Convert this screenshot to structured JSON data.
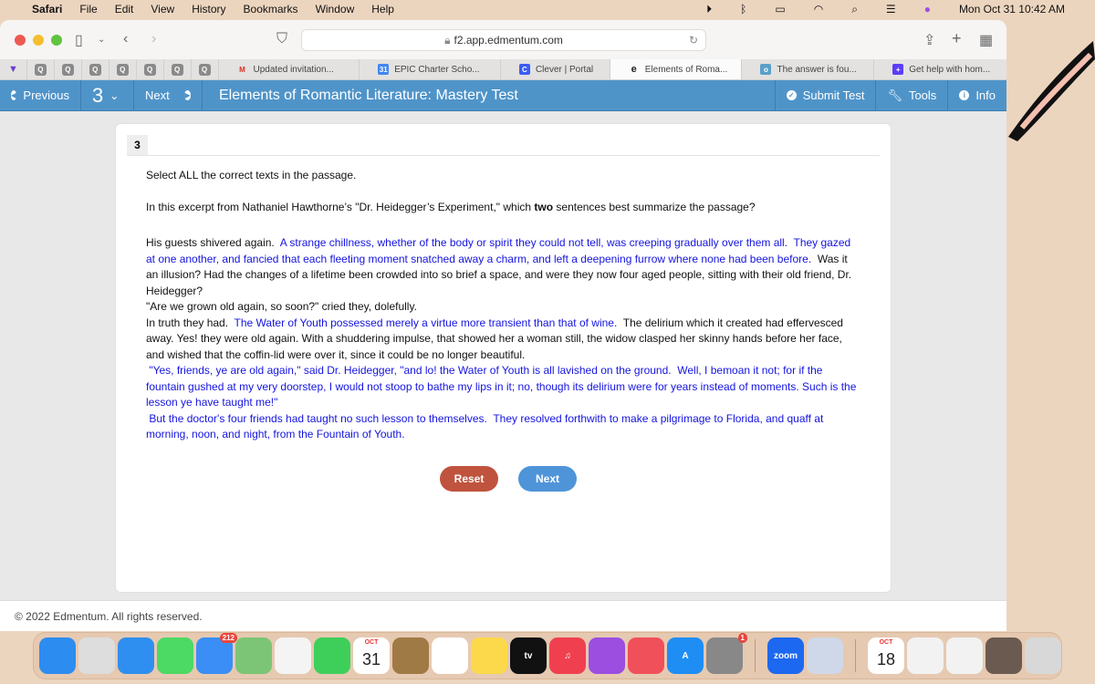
{
  "menubar": {
    "app": "Safari",
    "items": [
      "File",
      "Edit",
      "View",
      "History",
      "Bookmarks",
      "Window",
      "Help"
    ],
    "datetime": "Mon Oct 31  10:42 AM"
  },
  "browser": {
    "url": "f2.app.edmentum.com",
    "tabs": [
      {
        "label": "Updated invitation...",
        "icon": "gmail-icon",
        "color": "#d93025"
      },
      {
        "label": "EPIC Charter Scho...",
        "icon": "calendar-icon",
        "color": "#4285f4"
      },
      {
        "label": "Clever | Portal",
        "icon": "clever-icon",
        "color": "#3b5cf5"
      },
      {
        "label": "Elements of Roma...",
        "icon": "edmentum-icon",
        "color": "#222",
        "active": true
      },
      {
        "label": "The answer is fou...",
        "icon": "owl-icon",
        "color": "#5aa0c8"
      },
      {
        "label": "Get help with hom...",
        "icon": "plus-icon",
        "color": "#5b3df5"
      }
    ],
    "quick_tab_label": "Q"
  },
  "testbar": {
    "previous": "Previous",
    "question_number": "3",
    "next": "Next",
    "title": "Elements of Romantic Literature: Mastery Test",
    "submit": "Submit Test",
    "tools": "Tools",
    "info": "Info",
    "color": "#4f94c9"
  },
  "question": {
    "number": "3",
    "instruction": "Select ALL the correct texts in the passage.",
    "prompt_before": "In this excerpt from Nathaniel Hawthorne’s \"Dr. Heidegger’s Experiment,\" which ",
    "prompt_bold": "two",
    "prompt_after": " sentences best summarize the passage?",
    "selectable_color": "#1414e0",
    "paragraphs": [
      [
        {
          "text": "His guests shivered again.  ",
          "sel": false
        },
        {
          "text": "A strange chillness, whether of the body or spirit they could not tell, was creeping gradually over them all.",
          "sel": true
        },
        {
          "text": "  ",
          "sel": false
        },
        {
          "text": "They gazed at one another, and fancied that each fleeting moment snatched away a charm, and left a deepening furrow where none had been before.",
          "sel": true
        },
        {
          "text": "  Was it an illusion? Had the changes of a lifetime been crowded into so brief a space, and were they now four aged people, sitting with their old friend, Dr. Heidegger?",
          "sel": false
        }
      ],
      [
        {
          "text": "\"Are we grown old again, so soon?\" cried they, dolefully.",
          "sel": false
        }
      ],
      [
        {
          "text": "In truth they had.  ",
          "sel": false
        },
        {
          "text": "The Water of Youth possessed merely a virtue more transient than that of wine.",
          "sel": true
        },
        {
          "text": "  The delirium which it created had effervesced away. Yes! they were old again. With a shuddering impulse, that showed her a woman still, the widow clasped her skinny hands before her face, and wished that the coffin-lid were over it, since it could be no longer beautiful.",
          "sel": false
        }
      ],
      [
        {
          "text": " \"Yes, friends, ye are old again,\" said Dr. Heidegger, \"and lo! the Water of Youth is all lavished on the ground.",
          "sel": true
        },
        {
          "text": "  ",
          "sel": false
        },
        {
          "text": "Well, I bemoan it not; for if the fountain gushed at my very doorstep, I would not stoop to bathe my lips in it; no, though its delirium were for years instead of moments. Such is the lesson ye have taught me!\"",
          "sel": true
        }
      ],
      [
        {
          "text": " But the doctor's four friends had taught no such lesson to themselves.",
          "sel": true
        },
        {
          "text": "  ",
          "sel": false
        },
        {
          "text": "They resolved forthwith to make a pilgrimage to Florida, and quaff at morning, noon, and night, from the Fountain of Youth.",
          "sel": true
        }
      ]
    ],
    "reset": "Reset",
    "next": "Next",
    "reset_color": "#c0533d",
    "next_color": "#4f94d8"
  },
  "footer": "© 2022 Edmentum. All rights reserved.",
  "dock": {
    "items": [
      {
        "name": "finder",
        "color": "#2d8cf0"
      },
      {
        "name": "launchpad",
        "color": "#ddd"
      },
      {
        "name": "safari",
        "color": "#2f8ff0"
      },
      {
        "name": "messages",
        "color": "#4cd964"
      },
      {
        "name": "mail",
        "color": "#3a8ef6",
        "badge": "212"
      },
      {
        "name": "maps",
        "color": "#7cc576"
      },
      {
        "name": "photos",
        "color": "#f4f4f4"
      },
      {
        "name": "facetime",
        "color": "#3ecf5a"
      },
      {
        "name": "calendar",
        "color": "#fff",
        "label": "31",
        "sub": "OCT"
      },
      {
        "name": "contacts",
        "color": "#a07a45"
      },
      {
        "name": "reminders",
        "color": "#fff"
      },
      {
        "name": "notes",
        "color": "#fcd94a"
      },
      {
        "name": "tv",
        "color": "#111",
        "label": "tv"
      },
      {
        "name": "music",
        "color": "#f0404f",
        "label": "♫"
      },
      {
        "name": "podcasts",
        "color": "#9b4ee0"
      },
      {
        "name": "news",
        "color": "#f0505a"
      },
      {
        "name": "app-store",
        "color": "#1e8ef5",
        "label": "A"
      },
      {
        "name": "system-preferences",
        "color": "#888",
        "badge": "1"
      },
      {
        "name": "zoom",
        "color": "#1d68f0",
        "label": "zoom"
      },
      {
        "name": "preview",
        "color": "#cfd8e8"
      },
      {
        "name": "calendar-window",
        "color": "#fff",
        "label": "18",
        "sub": "OCT"
      },
      {
        "name": "safari-window-1",
        "color": "#f2f2f2"
      },
      {
        "name": "safari-window-2",
        "color": "#f2f2f2"
      },
      {
        "name": "safari-window-3",
        "color": "#6b5a50"
      },
      {
        "name": "trash",
        "color": "#d8d8d8"
      }
    ]
  }
}
